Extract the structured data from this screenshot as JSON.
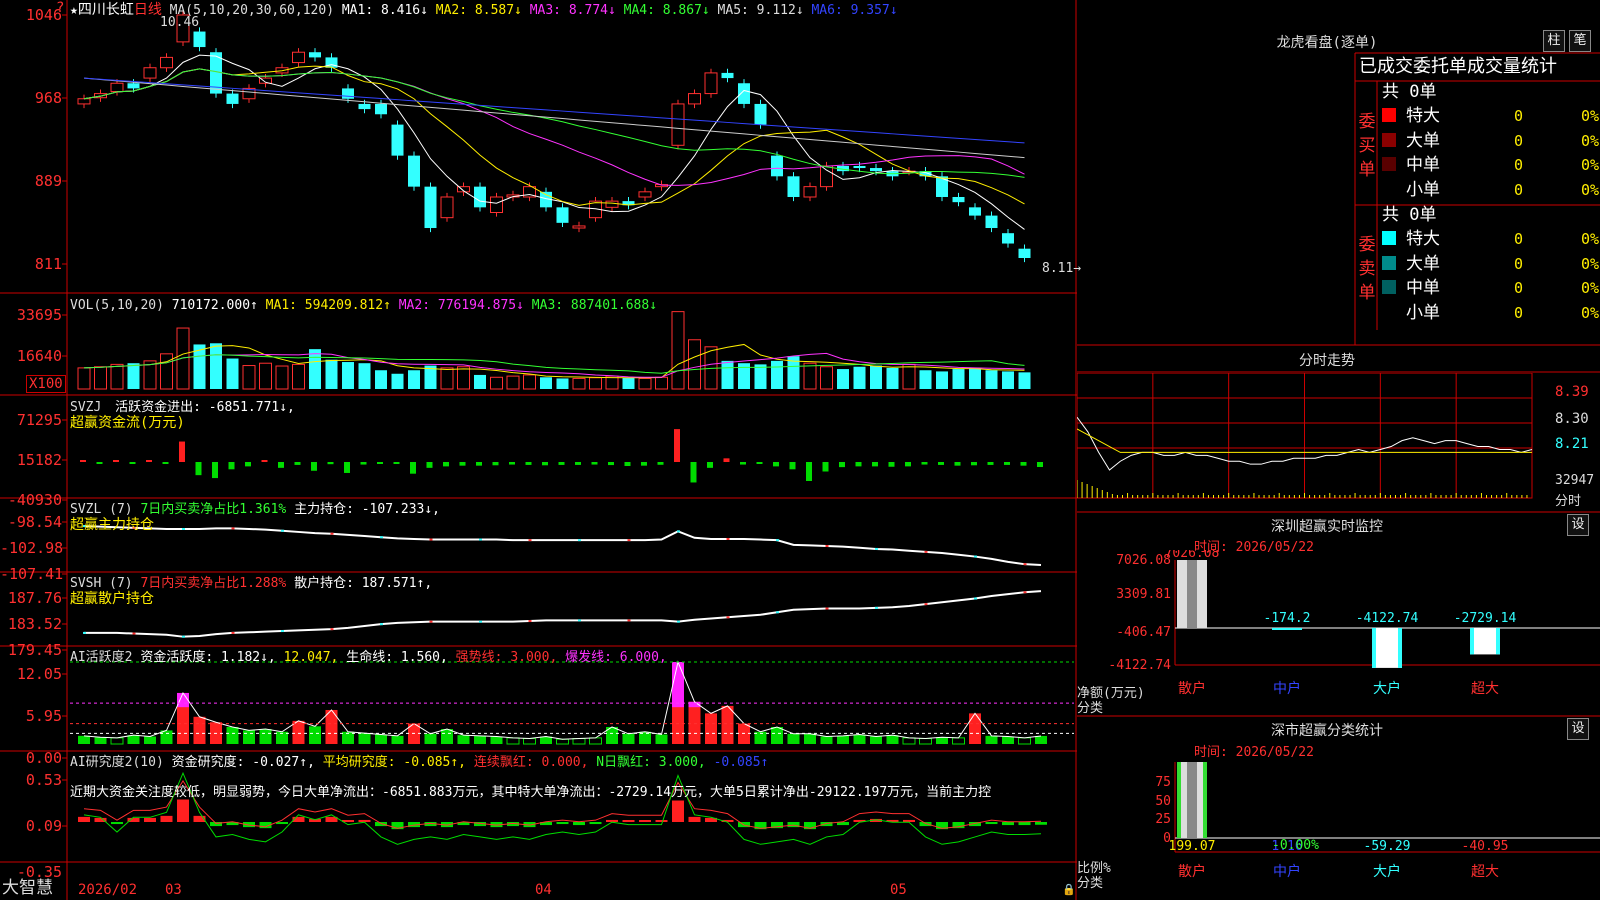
{
  "stock": {
    "star": "★",
    "name": "四川长虹",
    "period": "日线",
    "ma_line": {
      "label": "MA(5,10,20,30,60,120)",
      "ma1": "MA1: 8.416↓",
      "ma2": "MA2: 8.587↓",
      "ma3": "MA3: 8.774↓",
      "ma4": "MA4: 8.867↓",
      "ma5": "MA5: 9.112↓",
      "ma6": "MA6: 9.357↓"
    },
    "high_mark": "10.46",
    "low_mark": "8.11→",
    "corner_mark": "?",
    "price_axis": [
      "1046",
      "968",
      "889",
      "811"
    ]
  },
  "vol": {
    "label": "VOL(5,10,20)",
    "value": "710172.000↑",
    "ma1": "MA1: 594209.812↑",
    "ma2": "MA2: 776194.875↓",
    "ma3": "MA3: 887401.688↓",
    "axis": [
      "33695",
      "16640"
    ],
    "unit": "X100"
  },
  "svzj": {
    "label": "SVZJ",
    "text": "活跃资金进出: -6851.771↓,",
    "sub": "超赢资金流(万元)",
    "axis": [
      "71295",
      "15182",
      "-40930"
    ]
  },
  "svzl": {
    "label": "SVZL (7)",
    "ratio": "7日内买卖净占比1.361%",
    "hold": "主力持仓: -107.233↓,",
    "sub": "超赢主力持仓",
    "axis": [
      "-98.54",
      "-102.98",
      "-107.41"
    ]
  },
  "svsh": {
    "label": "SVSH (7)",
    "ratio": "7日内买卖净占比1.288%",
    "hold": "散户持仓: 187.571↑,",
    "sub": "超赢散户持仓",
    "axis": [
      "187.76",
      "183.52",
      "179.45"
    ]
  },
  "ai_active": {
    "label": "AI活跃度2",
    "v1": "资金活跃度: 1.182↓,",
    "v2": "12.047,",
    "v3": "生命线: 1.560,",
    "v4": "强势线: 3.000,",
    "v5": "爆发线: 6.000,",
    "axis": [
      "12.05",
      "5.95",
      "0.00"
    ]
  },
  "ai_research": {
    "label": "AI研究度2(10)",
    "v1": "资金研究度: -0.027↑,",
    "v2": "平均研究度: -0.085↑,",
    "v3": "连续飘红: 0.000,",
    "v4": "N日飘红: 3.000,",
    "v5": "-0.085↑",
    "note": "近期大资金关注度较低，明显弱势，今日大单净流出：-6851.883万元，其中特大单净流出：-2729.14万元，大单5日累计净出-29122.197万元，当前主力控",
    "axis": [
      "0.53",
      "0.09",
      "-0.35"
    ]
  },
  "footer": {
    "brand": "大智慧",
    "dates": [
      "2026/02",
      "03",
      "04",
      "05"
    ]
  },
  "dragon": {
    "title": "龙虎看盘(逐单)",
    "btn1": "柱",
    "btn2": "笔",
    "subtitle": "已成交委托单成交量统计",
    "buy": {
      "label": "委买单",
      "total": "共 0单",
      "rows": [
        {
          "name": "特大",
          "count": "0",
          "pct": "0%",
          "color": "#ff0000"
        },
        {
          "name": "大单",
          "count": "0",
          "pct": "0%",
          "color": "#8b0000"
        },
        {
          "name": "中单",
          "count": "0",
          "pct": "0%",
          "color": "#5a0000"
        },
        {
          "name": "小单",
          "count": "0",
          "pct": "0%",
          "color": "#000000"
        }
      ]
    },
    "sell": {
      "label": "委卖单",
      "total": "共 0单",
      "rows": [
        {
          "name": "特大",
          "count": "0",
          "pct": "0%",
          "color": "#00ffff"
        },
        {
          "name": "大单",
          "count": "0",
          "pct": "0%",
          "color": "#008b8b"
        },
        {
          "name": "中单",
          "count": "0",
          "pct": "0%",
          "color": "#006060"
        },
        {
          "name": "小单",
          "count": "0",
          "pct": "0%",
          "color": "#000000"
        }
      ]
    }
  },
  "intraday": {
    "title": "分时走势",
    "axis": [
      "8.39",
      "8.30",
      "8.21"
    ],
    "vol": "32947",
    "unit": "分时"
  },
  "sz_monitor": {
    "title": "深圳超赢实时监控",
    "btn": "设",
    "time": "时间: 2026/05/22",
    "axis": [
      "7026.08",
      "3309.81",
      "-406.47",
      "-4122.74"
    ],
    "ylabel": "净额(万元)",
    "xlabel": "分类",
    "bars": [
      {
        "name": "散户",
        "value": "7026.08"
      },
      {
        "name": "中户",
        "value": "-174.2"
      },
      {
        "name": "大户",
        "value": "-4122.74"
      },
      {
        "name": "超大",
        "value": "-2729.14"
      }
    ]
  },
  "sz_class": {
    "title": "深市超赢分类统计",
    "btn": "设",
    "time": "时间: 2026/05/22",
    "axis": [
      "75",
      "50",
      "25",
      "0"
    ],
    "ylabel": "比例%",
    "xlabel": "分类",
    "mid": "-0.00%",
    "bars": [
      {
        "name": "散户",
        "value": "199.07"
      },
      {
        "name": "中户",
        "value": "1.16"
      },
      {
        "name": "大户",
        "value": "-59.29"
      },
      {
        "name": "超大",
        "value": "-40.95"
      }
    ]
  },
  "chart_data": [
    {
      "type": "candlestick",
      "title": "四川长虹 日线",
      "ylim": [
        8.11,
        10.46
      ],
      "note": "approximate daily candles [open, close] in price units",
      "candles": [
        [
          9.6,
          9.65
        ],
        [
          9.66,
          9.7
        ],
        [
          9.72,
          9.8
        ],
        [
          9.8,
          9.75
        ],
        [
          9.85,
          9.95
        ],
        [
          9.95,
          10.05
        ],
        [
          10.2,
          10.46
        ],
        [
          10.3,
          10.15
        ],
        [
          10.1,
          9.7
        ],
        [
          9.7,
          9.6
        ],
        [
          9.65,
          9.75
        ],
        [
          9.8,
          9.85
        ],
        [
          9.9,
          9.95
        ],
        [
          10.0,
          10.1
        ],
        [
          10.1,
          10.05
        ],
        [
          10.05,
          9.95
        ],
        [
          9.75,
          9.65
        ],
        [
          9.6,
          9.55
        ],
        [
          9.6,
          9.5
        ],
        [
          9.4,
          9.1
        ],
        [
          9.1,
          8.8
        ],
        [
          8.8,
          8.4
        ],
        [
          8.5,
          8.7
        ],
        [
          8.75,
          8.8
        ],
        [
          8.8,
          8.6
        ],
        [
          8.55,
          8.7
        ],
        [
          8.7,
          8.72
        ],
        [
          8.7,
          8.8
        ],
        [
          8.75,
          8.6
        ],
        [
          8.6,
          8.45
        ],
        [
          8.4,
          8.42
        ],
        [
          8.5,
          8.66
        ],
        [
          8.6,
          8.66
        ],
        [
          8.66,
          8.62
        ],
        [
          8.7,
          8.75
        ],
        [
          8.8,
          8.82
        ],
        [
          9.2,
          9.6
        ],
        [
          9.6,
          9.7
        ],
        [
          9.7,
          9.9
        ],
        [
          9.9,
          9.85
        ],
        [
          9.8,
          9.6
        ],
        [
          9.6,
          9.4
        ],
        [
          9.1,
          8.9
        ],
        [
          8.9,
          8.7
        ],
        [
          8.7,
          8.8
        ],
        [
          8.8,
          9.0
        ],
        [
          9.0,
          8.95
        ],
        [
          9.0,
          8.98
        ],
        [
          8.98,
          8.95
        ],
        [
          8.95,
          8.9
        ],
        [
          8.95,
          8.95
        ],
        [
          8.95,
          8.9
        ],
        [
          8.9,
          8.7
        ],
        [
          8.7,
          8.65
        ],
        [
          8.6,
          8.52
        ],
        [
          8.52,
          8.4
        ],
        [
          8.35,
          8.25
        ],
        [
          8.2,
          8.11
        ]
      ]
    },
    {
      "type": "bar",
      "title": "VOL(5,10,20)",
      "ylim": [
        0,
        33695
      ],
      "values": [
        9000,
        9500,
        10500,
        11000,
        12000,
        15000,
        26000,
        19000,
        19500,
        13000,
        10000,
        11000,
        9800,
        10500,
        17000,
        12500,
        11500,
        11000,
        8000,
        6500,
        8000,
        10000,
        9000,
        9500,
        6000,
        5000,
        5500,
        6000,
        5000,
        4500,
        4500,
        4800,
        5500,
        4700,
        4500,
        5000,
        33000,
        21000,
        18000,
        12000,
        11000,
        10500,
        12000,
        14000,
        11000,
        9500,
        8500,
        9500,
        10000,
        9000,
        10500,
        8000,
        7500,
        8500,
        9000,
        8000,
        7500,
        7100
      ]
    },
    {
      "type": "bar",
      "title": "超赢资金流(万元)",
      "ylim": [
        -40930,
        71295
      ],
      "values": [
        800,
        -900,
        600,
        -700,
        500,
        -400,
        28000,
        -18000,
        -22000,
        -10000,
        -6000,
        2500,
        -8000,
        -4000,
        -12000,
        -3000,
        -15000,
        -3500,
        -1500,
        -1200,
        -16000,
        -8000,
        -6000,
        -5000,
        -5000,
        -4500,
        -3500,
        -4000,
        -4500,
        -4000,
        -4000,
        -3500,
        -4200,
        -5500,
        -5000,
        -3800,
        45000,
        -28000,
        -8000,
        5000,
        -3500,
        -2000,
        -6000,
        -10000,
        -26000,
        -13000,
        -7000,
        -6000,
        -6000,
        -6500,
        -6000,
        -3500,
        -4000,
        -5000,
        -4500,
        -4000,
        -4000,
        -5000,
        -6851.771
      ]
    },
    {
      "type": "line",
      "title": "超赢主力持仓",
      "ylim": [
        -107.41,
        -98.54
      ],
      "values": [
        -100.6,
        -100.7,
        -100.8,
        -100.9,
        -101.0,
        -101.1,
        -101.1,
        -101.1,
        -101.0,
        -101.0,
        -101.1,
        -101.2,
        -101.4,
        -101.6,
        -101.8,
        -101.9,
        -102.1,
        -102.3,
        -102.5,
        -102.7,
        -102.8,
        -102.9,
        -102.9,
        -102.9,
        -102.9,
        -102.9,
        -103.0,
        -103.0,
        -103.0,
        -103.0,
        -103.0,
        -103.0,
        -103.0,
        -103.0,
        -103.0,
        -102.9,
        -101.5,
        -102.6,
        -102.8,
        -102.8,
        -102.8,
        -102.9,
        -103.0,
        -103.8,
        -103.9,
        -104.0,
        -104.1,
        -104.3,
        -104.5,
        -104.6,
        -104.8,
        -105.0,
        -105.2,
        -105.5,
        -105.8,
        -106.2,
        -106.7,
        -107.1,
        -107.233
      ]
    },
    {
      "type": "line",
      "title": "超赢散户持仓",
      "ylim": [
        179.45,
        187.76
      ],
      "values": [
        180.9,
        180.9,
        180.9,
        180.8,
        180.7,
        180.6,
        180.3,
        180.4,
        180.7,
        180.9,
        181.0,
        181.1,
        181.2,
        181.3,
        181.4,
        181.5,
        181.7,
        182.0,
        182.3,
        182.5,
        182.6,
        182.7,
        182.7,
        182.7,
        182.7,
        182.7,
        182.7,
        182.8,
        182.9,
        182.9,
        182.9,
        182.9,
        182.9,
        182.9,
        182.9,
        182.9,
        182.7,
        183.0,
        183.2,
        183.4,
        183.6,
        183.8,
        184.2,
        184.6,
        184.7,
        184.8,
        184.8,
        184.8,
        184.9,
        185.0,
        185.2,
        185.5,
        185.8,
        186.1,
        186.4,
        186.8,
        187.1,
        187.4,
        187.571
      ]
    },
    {
      "type": "bar",
      "title": "AI活跃度2",
      "ylim": [
        0,
        12.05
      ],
      "values": [
        1.2,
        1.0,
        0.9,
        1.3,
        1.1,
        2.0,
        7.5,
        4.0,
        3.2,
        2.5,
        2.0,
        2.2,
        1.8,
        3.4,
        2.6,
        5.0,
        1.8,
        1.6,
        1.4,
        1.2,
        3.0,
        1.5,
        2.2,
        1.3,
        1.2,
        1.1,
        0.9,
        0.8,
        1.1,
        0.7,
        0.8,
        0.9,
        2.5,
        1.5,
        1.8,
        1.4,
        12.047,
        6.2,
        4.5,
        5.6,
        3.0,
        1.8,
        2.5,
        1.5,
        1.5,
        1.1,
        1.2,
        1.4,
        1.1,
        1.3,
        0.9,
        0.8,
        1.0,
        0.9,
        4.5,
        1.2,
        1.1,
        0.9,
        1.182
      ],
      "series": [
        {
          "name": "生命线",
          "value": 1.56
        },
        {
          "name": "强势线",
          "value": 3.0
        },
        {
          "name": "爆发线",
          "value": 6.0
        }
      ]
    },
    {
      "type": "bar",
      "title": "AI研究度2(10)",
      "ylim": [
        -0.35,
        0.53
      ],
      "values": [
        0.05,
        0.04,
        -0.02,
        0.04,
        0.04,
        0.06,
        0.22,
        0.06,
        -0.04,
        -0.03,
        -0.05,
        -0.06,
        -0.02,
        0.05,
        0.03,
        0.05,
        0.01,
        0.02,
        -0.04,
        -0.07,
        -0.05,
        -0.04,
        -0.05,
        -0.03,
        -0.04,
        -0.05,
        -0.04,
        -0.05,
        -0.03,
        -0.02,
        -0.03,
        -0.02,
        0.02,
        0.01,
        0.01,
        0.01,
        0.21,
        0.05,
        0.04,
        0.02,
        -0.05,
        -0.07,
        -0.06,
        -0.05,
        -0.07,
        -0.04,
        -0.03,
        0.02,
        0.03,
        0.02,
        0.02,
        -0.04,
        -0.07,
        -0.06,
        -0.04,
        -0.02,
        -0.03,
        -0.03,
        -0.027
      ]
    },
    {
      "type": "bar",
      "title": "深圳超赢实时监控",
      "categories": [
        "散户",
        "中户",
        "大户",
        "超大"
      ],
      "values": [
        7026.08,
        -174.2,
        -4122.74,
        -2729.14
      ],
      "ylabel": "净额(万元)",
      "xlabel": "分类",
      "ylim": [
        -4122.74,
        7026.08
      ]
    },
    {
      "type": "bar",
      "title": "深市超赢分类统计",
      "categories": [
        "散户",
        "中户",
        "大户",
        "超大"
      ],
      "values": [
        199.07,
        1.16,
        -59.29,
        -40.95
      ],
      "ylabel": "比例%",
      "xlabel": "分类",
      "ylim": [
        0,
        75
      ]
    },
    {
      "type": "line",
      "title": "分时走势",
      "ylim": [
        8.11,
        8.45
      ],
      "note": "approximate intraday path (price units)",
      "values": [
        8.3,
        8.25,
        8.18,
        8.12,
        8.15,
        8.17,
        8.18,
        8.18,
        8.17,
        8.17,
        8.18,
        8.17,
        8.17,
        8.16,
        8.15,
        8.15,
        8.14,
        8.14,
        8.15,
        8.15,
        8.16,
        8.16,
        8.16,
        8.17,
        8.17,
        8.18,
        8.19,
        8.18,
        8.19,
        8.2,
        8.22,
        8.23,
        8.22,
        8.21,
        8.22,
        8.22,
        8.21,
        8.2,
        8.2,
        8.19,
        8.19,
        8.18,
        8.19
      ]
    }
  ]
}
